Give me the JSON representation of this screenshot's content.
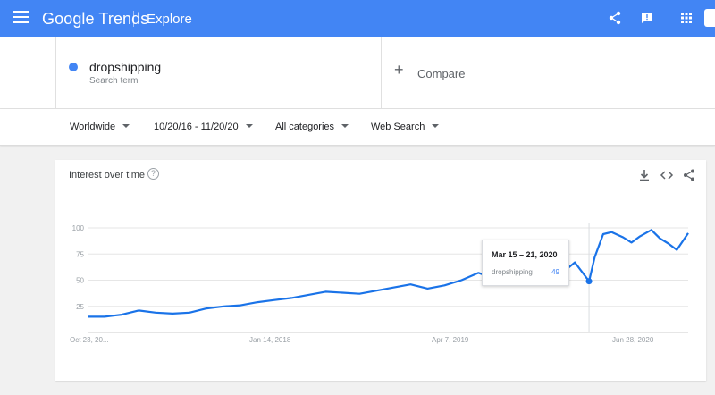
{
  "app": {
    "logo": "Google Trends",
    "section": "Explore"
  },
  "icons": {
    "menu": "menu-icon",
    "share": "share-icon",
    "feedback": "feedback-icon",
    "apps": "apps-grid-icon",
    "help": "help-icon",
    "download": "download-icon",
    "embed": "embed-code-icon",
    "chart_share": "share-icon"
  },
  "colors": {
    "brand": "#4285f4",
    "series": "#1a73e8"
  },
  "search_term": {
    "name": "dropshipping",
    "subtitle": "Search term",
    "dot_color": "#4285f4"
  },
  "compare": {
    "plus": "+",
    "label": "Compare"
  },
  "filters": {
    "region": "Worldwide",
    "date_range": "10/20/16 - 11/20/20",
    "category": "All categories",
    "search_type": "Web Search"
  },
  "card": {
    "title": "Interest over time",
    "help": "?"
  },
  "tooltip": {
    "date": "Mar 15 – 21, 2020",
    "term": "dropshipping",
    "value": "49"
  },
  "chart_data": {
    "type": "line",
    "title": "Interest over time",
    "ylim": [
      0,
      100
    ],
    "yticks": [
      "100",
      "75",
      "50",
      "25"
    ],
    "xtick_labels": [
      "Oct 23, 20...",
      "Jan 14, 2018",
      "Apr 7, 2019",
      "Jun 28, 2020"
    ],
    "grid": true,
    "series": [
      {
        "name": "dropshipping",
        "x": [
          "2016-10-23",
          "2016-12-04",
          "2017-01-15",
          "2017-02-26",
          "2017-04-09",
          "2017-05-21",
          "2017-07-02",
          "2017-08-13",
          "2017-09-24",
          "2017-11-05",
          "2017-12-17",
          "2018-01-28",
          "2018-03-11",
          "2018-04-22",
          "2018-06-03",
          "2018-07-15",
          "2018-08-26",
          "2018-10-07",
          "2018-11-18",
          "2018-12-30",
          "2019-02-10",
          "2019-03-24",
          "2019-05-05",
          "2019-06-16",
          "2019-07-28",
          "2019-09-08",
          "2019-10-20",
          "2019-12-01",
          "2020-01-12",
          "2020-02-09",
          "2020-03-15",
          "2020-03-29",
          "2020-04-19",
          "2020-05-10",
          "2020-06-07",
          "2020-06-28",
          "2020-07-19",
          "2020-08-16",
          "2020-09-06",
          "2020-09-27",
          "2020-10-18",
          "2020-11-15"
        ],
        "values": [
          15,
          15,
          17,
          21,
          19,
          18,
          19,
          23,
          25,
          26,
          29,
          31,
          33,
          36,
          39,
          38,
          37,
          40,
          43,
          46,
          42,
          45,
          50,
          57,
          51,
          50,
          50,
          53,
          58,
          67,
          49,
          72,
          94,
          96,
          91,
          86,
          92,
          98,
          90,
          85,
          79,
          95
        ]
      }
    ]
  }
}
